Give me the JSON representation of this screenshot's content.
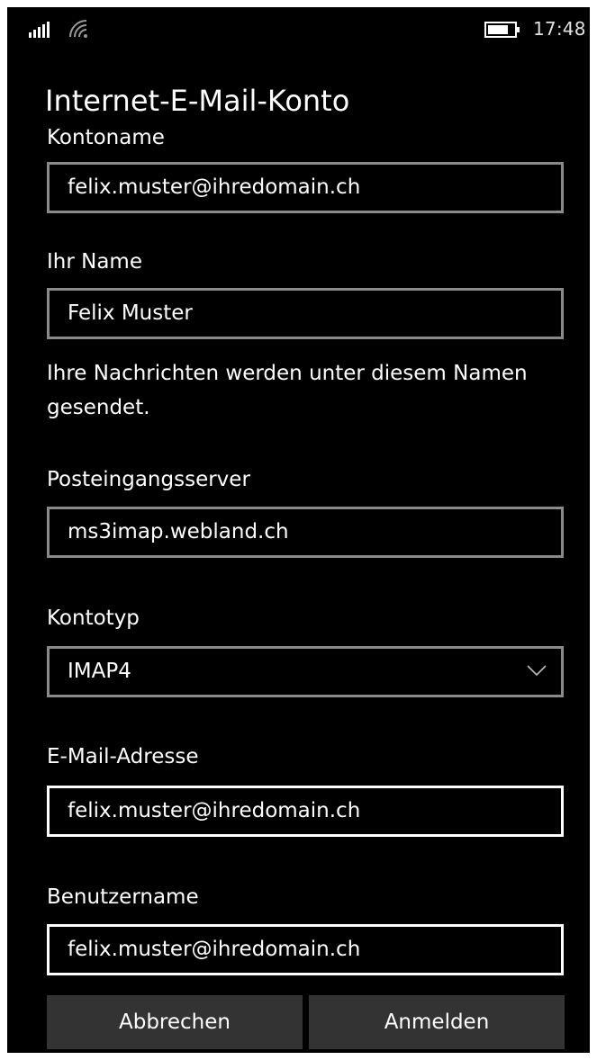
{
  "status_bar": {
    "signal_icon": "signal-bars-icon",
    "wifi_icon": "wifi-icon",
    "battery_icon": "battery-icon",
    "time": "17:48"
  },
  "page": {
    "title": "Internet-E-Mail-Konto"
  },
  "form": {
    "account_name": {
      "label": "Kontoname",
      "value": "felix.muster@ihredomain.ch"
    },
    "your_name": {
      "label": "Ihr Name",
      "value": "Felix Muster",
      "hint": "Ihre Nachrichten werden unter diesem Namen gesendet."
    },
    "incoming_server": {
      "label": "Posteingangsserver",
      "value": "ms3imap.webland.ch"
    },
    "account_type": {
      "label": "Kontotyp",
      "selected": "IMAP4",
      "icon": "chevron-down-icon"
    },
    "email_address": {
      "label": "E-Mail-Adresse",
      "value": "felix.muster@ihredomain.ch"
    },
    "username": {
      "label": "Benutzername",
      "value": "felix.muster@ihredomain.ch"
    }
  },
  "buttons": {
    "cancel": "Abbrechen",
    "sign_in": "Anmelden"
  },
  "colors": {
    "background": "#000000",
    "text": "#ffffff",
    "field_border_inactive": "#8a8a8a",
    "field_border_active": "#ffffff",
    "button_bg": "#333333"
  }
}
